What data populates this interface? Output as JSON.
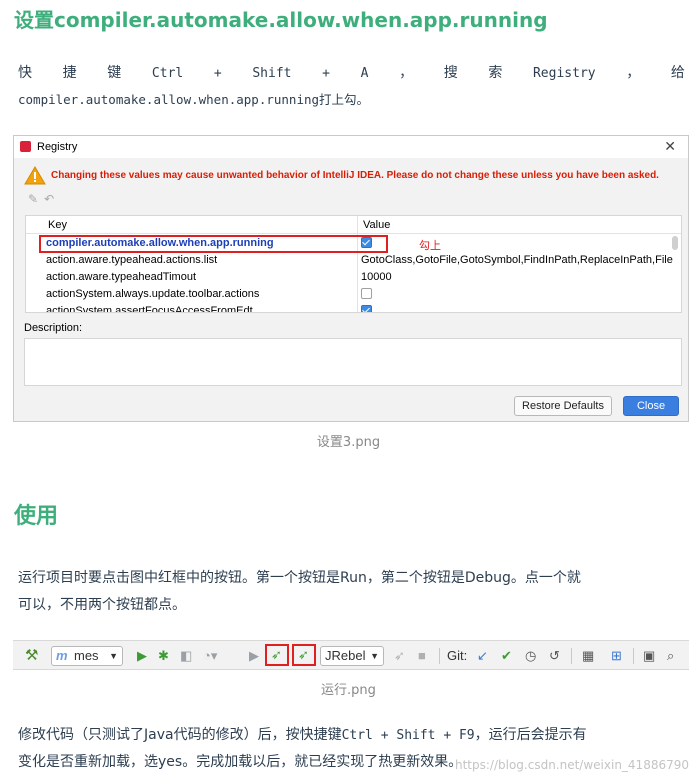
{
  "section1": {
    "title": "设置compiler.automake.allow.when.app.running",
    "para_line1": [
      "快",
      "捷",
      "键",
      "Ctrl",
      "+",
      "Shift",
      "+",
      "A",
      "，",
      "搜",
      "索",
      "Registry",
      "，",
      "给"
    ],
    "para_line2": "compiler.automake.allow.when.app.running打上勾。"
  },
  "registry": {
    "title": "Registry",
    "warning": "Changing these values may cause unwanted behavior of IntelliJ IDEA. Please do not change these unless you have been asked.",
    "col_key": "Key",
    "col_value": "Value",
    "rows": [
      {
        "key": "compiler.automake.allow.when.app.running",
        "value": "",
        "checkbox": true,
        "checked": true
      },
      {
        "key": "action.aware.typeahead.actions.list",
        "value": "GotoClass,GotoFile,GotoSymbol,FindInPath,ReplaceInPath,FileStruc",
        "checkbox": false
      },
      {
        "key": "action.aware.typeaheadTimout",
        "value": "10000",
        "checkbox": false
      },
      {
        "key": "actionSystem.always.update.toolbar.actions",
        "value": "",
        "checkbox": true,
        "checked": false
      },
      {
        "key": "actionSystem.assertFocusAccessFromEdt",
        "value": "",
        "checkbox": true,
        "checked": true
      }
    ],
    "annotation": "勾上",
    "description_label": "Description:",
    "restore_button": "Restore Defaults",
    "close_button": "Close"
  },
  "caption1": "设置3.png",
  "section2": {
    "title": "使用",
    "para_line1": "运行项目时要点击图中红框中的按钮。第一个按钮是Run，第二个按钮是Debug。点一个就",
    "para_line2": "可以，不用两个按钮都点。"
  },
  "ide_toolbar": {
    "config_name": "mes",
    "jrebel_combo": "JRebel",
    "git_label": "Git:"
  },
  "caption2": "运行.png",
  "section3": {
    "line1_a": "修改代码（只测试了Java代码的修改）后，按快捷键",
    "line1_mono": "Ctrl + Shift + F9",
    "line1_b": "，运行后会提示有",
    "line2": "变化是否重新加载，选yes。完成加载以后，就已经实现了热更新效果。"
  },
  "watermark": "https://blog.csdn.net/weixin_41886790",
  "colors": {
    "heading": "#3eaf7c",
    "warning": "#d81e06",
    "highlight": "#e02020",
    "primary_button": "#3a7fe0"
  }
}
